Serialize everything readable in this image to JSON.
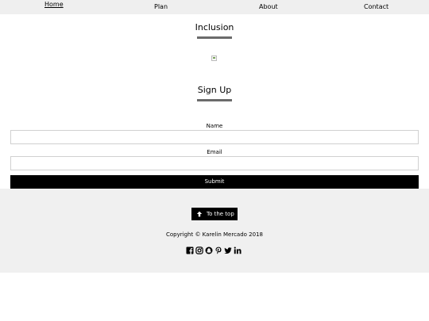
{
  "nav": {
    "items": [
      {
        "label": "Home",
        "active": true
      },
      {
        "label": "Plan",
        "active": false
      },
      {
        "label": "About",
        "active": false
      },
      {
        "label": "Contact",
        "active": false
      }
    ]
  },
  "inclusion": {
    "title": "Inclusion"
  },
  "signup": {
    "title": "Sign Up",
    "name_label": "Name",
    "name_value": "",
    "email_label": "Email",
    "email_value": "",
    "submit_label": "Submit"
  },
  "footer": {
    "top_button_label": "To the top",
    "top_icon": "arrow-up-icon",
    "copyright": "Copyright © Karelin Mercado 2018",
    "social_icons": [
      "facebook-icon",
      "instagram-icon",
      "snapchat-icon",
      "pinterest-icon",
      "twitter-icon",
      "linkedin-icon"
    ]
  },
  "colors": {
    "nav_bg": "#efefef",
    "footer_bg": "#f0f0f0",
    "title_underline": "#6b6b6b",
    "button_bg": "#000000",
    "button_text": "#ffffff"
  }
}
